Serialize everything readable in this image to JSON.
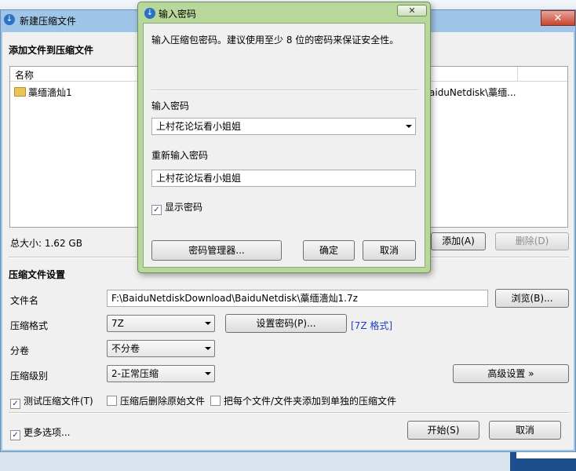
{
  "main": {
    "title": "新建压缩文件",
    "close_symbol": "✕",
    "add_section_title": "添加文件到压缩文件",
    "list_header_name": "名称",
    "files": [
      {
        "name": "藁缅濇灿1",
        "path": "aiduNetdisk\\藁缅..."
      }
    ],
    "total_size": "总大小: 1.62 GB",
    "add_button": "添加(A)",
    "delete_button": "删除(D)",
    "settings_title": "压缩文件设置",
    "filename_label": "文件名",
    "filename_value": "F:\\BaiduNetdiskDownload\\BaiduNetdisk\\藁缅濇灿1.7z",
    "browse_button": "浏览(B)...",
    "format_label": "压缩格式",
    "format_value": "7Z",
    "set_password_button": "设置密码(P)...",
    "format_link": "[7Z 格式]",
    "volume_label": "分卷",
    "volume_value": "不分卷",
    "level_label": "压缩级别",
    "level_value": "2-正常压缩",
    "advanced_button": "高级设置 »",
    "test_checkbox": "测试压缩文件(T)",
    "test_checked": true,
    "delete_after_checkbox": "压缩后删除原始文件",
    "delete_after_checked": false,
    "separate_checkbox": "把每个文件/文件夹添加到单独的压缩文件",
    "separate_checked": false,
    "more_options_checkbox": "更多选项...",
    "more_options_checked": true,
    "start_button": "开始(S)",
    "cancel_button": "取消"
  },
  "dialog": {
    "title": "输入密码",
    "close_symbol": "✕",
    "description": "输入压缩包密码。建议使用至少 8 位的密码来保证安全性。",
    "password_label": "输入密码",
    "password_value": "上村花论坛看小姐姐",
    "confirm_label": "重新输入密码",
    "confirm_value": "上村花论坛看小姐姐",
    "show_password_checkbox": "显示密码",
    "show_password_checked": true,
    "manager_button": "密码管理器...",
    "ok_button": "确定",
    "cancel_button": "取消"
  },
  "icons": {
    "app": "bandizip-app-icon",
    "folder": "folder-icon",
    "check": "check-icon"
  },
  "colors": {
    "main_frame": "#9fc6e8",
    "dialog_frame": "#b7d79b",
    "close_red": "#c7452f",
    "link_blue": "#1f3fbf"
  }
}
